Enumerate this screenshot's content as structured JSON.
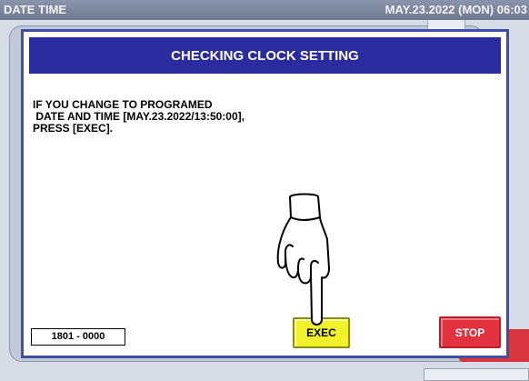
{
  "status_bar": {
    "title": "DATE TIME",
    "datetime": "MAY.23.2022 (MON)  06:03"
  },
  "dialog": {
    "title": "CHECKING CLOCK SETTING",
    "message": "IF YOU CHANGE TO PROGRAMED\n DATE AND TIME [MAY.23.2022/13:50:00],\nPRESS [EXEC].",
    "code": "1801 - 0000",
    "exec_label": "EXEC",
    "stop_label": "STOP"
  },
  "colors": {
    "header_bg": "#2a2b9e",
    "exec_button": "#f2f22b",
    "stop_button": "#e2313f",
    "status_bar": "#7b86a0"
  },
  "icons": {
    "pointer": "pointing-hand-icon"
  }
}
